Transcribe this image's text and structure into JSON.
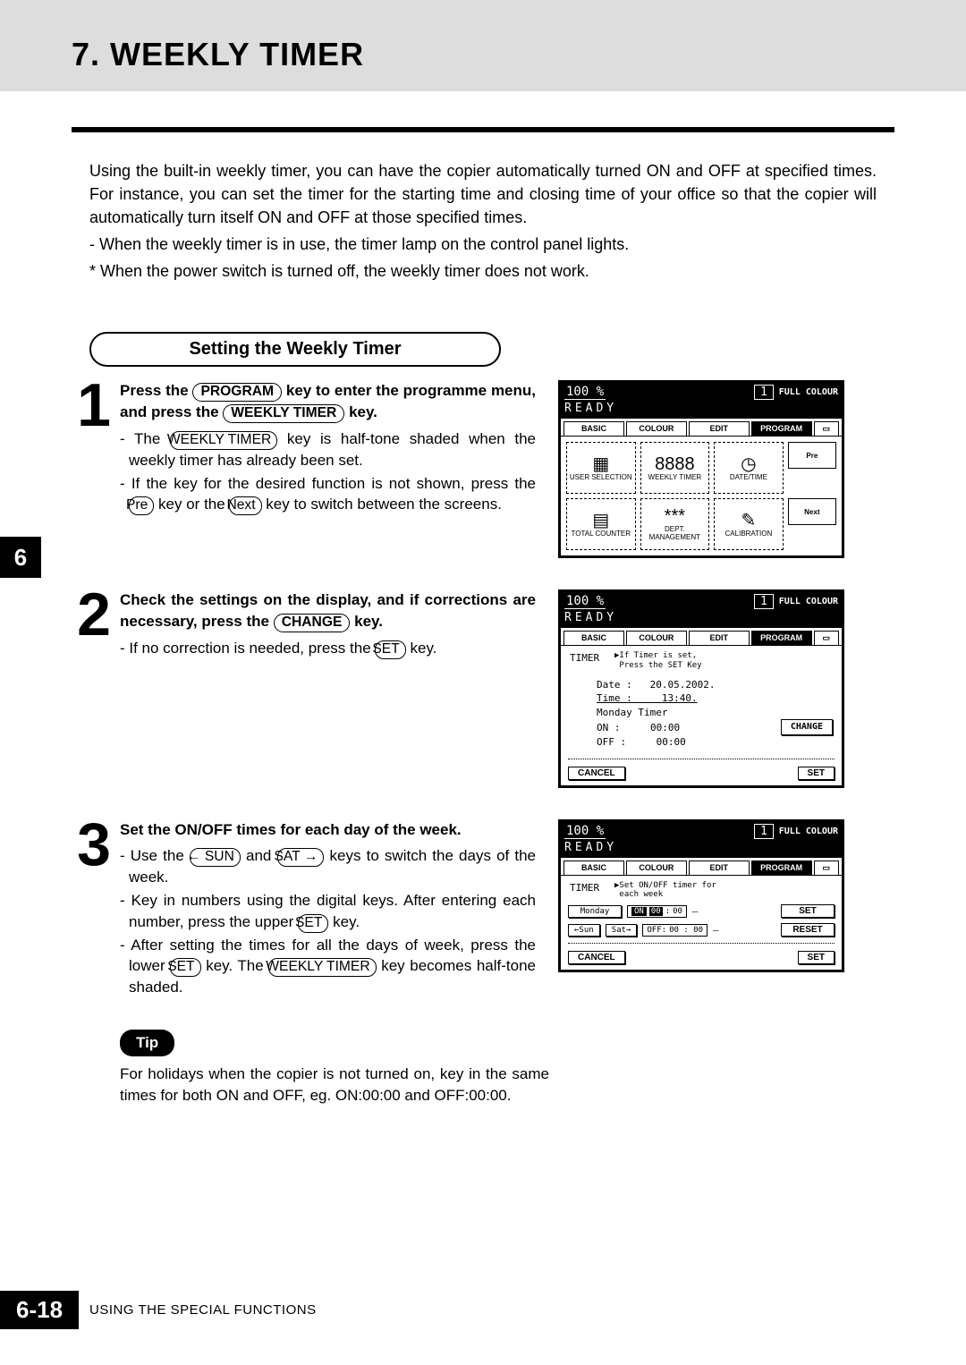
{
  "header": {
    "title": "7. WEEKLY TIMER"
  },
  "intro": {
    "p1": "Using the built-in weekly timer, you can have the copier automatically turned ON and OFF at specified times.  For instance, you can set the timer for the starting time and closing time of your office so that the copier will automatically turn itself ON and OFF at those specified times.",
    "b1": "- When the weekly timer is in use, the timer lamp on the control panel lights.",
    "b2": "* When the power switch is turned off, the weekly timer does not work."
  },
  "section_header": "Setting the Weekly Timer",
  "steps": [
    {
      "num": "1",
      "title_a": "Press the ",
      "key1": "PROGRAM",
      "title_b": " key to enter the programme menu, and press the ",
      "key2": "WEEKLY TIMER",
      "title_c": " key.",
      "d1a": "- The ",
      "d1key": "WEEKLY TIMER",
      "d1b": " key is half-tone shaded when the weekly timer has already been set.",
      "d2a": "- If the key for the desired function is not shown, press the ",
      "d2k1": "Pre",
      "d2b": " key or the ",
      "d2k2": "Next",
      "d2c": " key to switch between the screens."
    },
    {
      "num": "2",
      "title_a": "Check the settings on the display, and if corrections are necessary, press the ",
      "key1": "CHANGE",
      "title_b": " key.",
      "d1a": "- If no correction is needed, press the ",
      "d1key": "SET",
      "d1b": " key."
    },
    {
      "num": "3",
      "title_a": "Set the ON/OFF times for each day of the week.",
      "d1a": "- Use the ",
      "d1k1": "← SUN",
      "d1b": " and ",
      "d1k2": "SAT →",
      "d1c": " keys to switch the days of the week.",
      "d2a": "- Key in numbers using the digital keys.  After entering each number, press the upper ",
      "d2k1": "SET",
      "d2b": " key.",
      "d3a": "- After setting the times for all the days of week, press the lower ",
      "d3k1": "SET",
      "d3b": " key.  The ",
      "d3k2": "WEEKLY TIMER",
      "d3c": " key becomes half-tone shaded."
    }
  ],
  "tip": {
    "label": "Tip",
    "text": "For holidays when the copier is not turned on, key in the same times for both ON and OFF, eg. ON:00:00 and OFF:00:00."
  },
  "side_tab": "6",
  "footer": {
    "page": "6-18",
    "text": "USING THE SPECIAL FUNCTIONS"
  },
  "lcd_common": {
    "pct": "100 %",
    "one": "1",
    "fc": "FULL COLOUR",
    "ready": "READY",
    "tabs": [
      "BASIC",
      "COLOUR",
      "EDIT",
      "PROGRAM"
    ]
  },
  "lcd1": {
    "btns": [
      "USER SELECTION",
      "WEEKLY TIMER",
      "DATE/TIME",
      "Pre",
      "TOTAL COUNTER",
      "DEPT. MANAGEMENT",
      "CALIBRATION",
      "Next"
    ],
    "icons": [
      "▦",
      "8888",
      "◷",
      "",
      "▤",
      "***",
      "✎",
      ""
    ]
  },
  "lcd2": {
    "label": "TIMER",
    "hint": "▶If Timer is set,\n Press the SET Key",
    "date_l": "Date :",
    "date_v": "20.05.2002.",
    "time_l": "Time :",
    "time_v": "13:40.",
    "mon": "Monday Timer",
    "on_l": "ON   :",
    "on_v": "00:00",
    "off_l": "OFF  :",
    "off_v": "00:00",
    "change": "CHANGE",
    "cancel": "CANCEL",
    "set": "SET"
  },
  "lcd3": {
    "label": "TIMER",
    "hint": "▶Set ON/OFF timer for\n each week",
    "day": "Monday",
    "on_l": "ON",
    "on_v1": "00",
    "on_v2": "00",
    "off_l": "OFF:",
    "off_v": "00 : 00",
    "sun": "←Sun",
    "sat": "Sat→",
    "set": "SET",
    "reset": "RESET",
    "cancel": "CANCEL",
    "set2": "SET"
  }
}
